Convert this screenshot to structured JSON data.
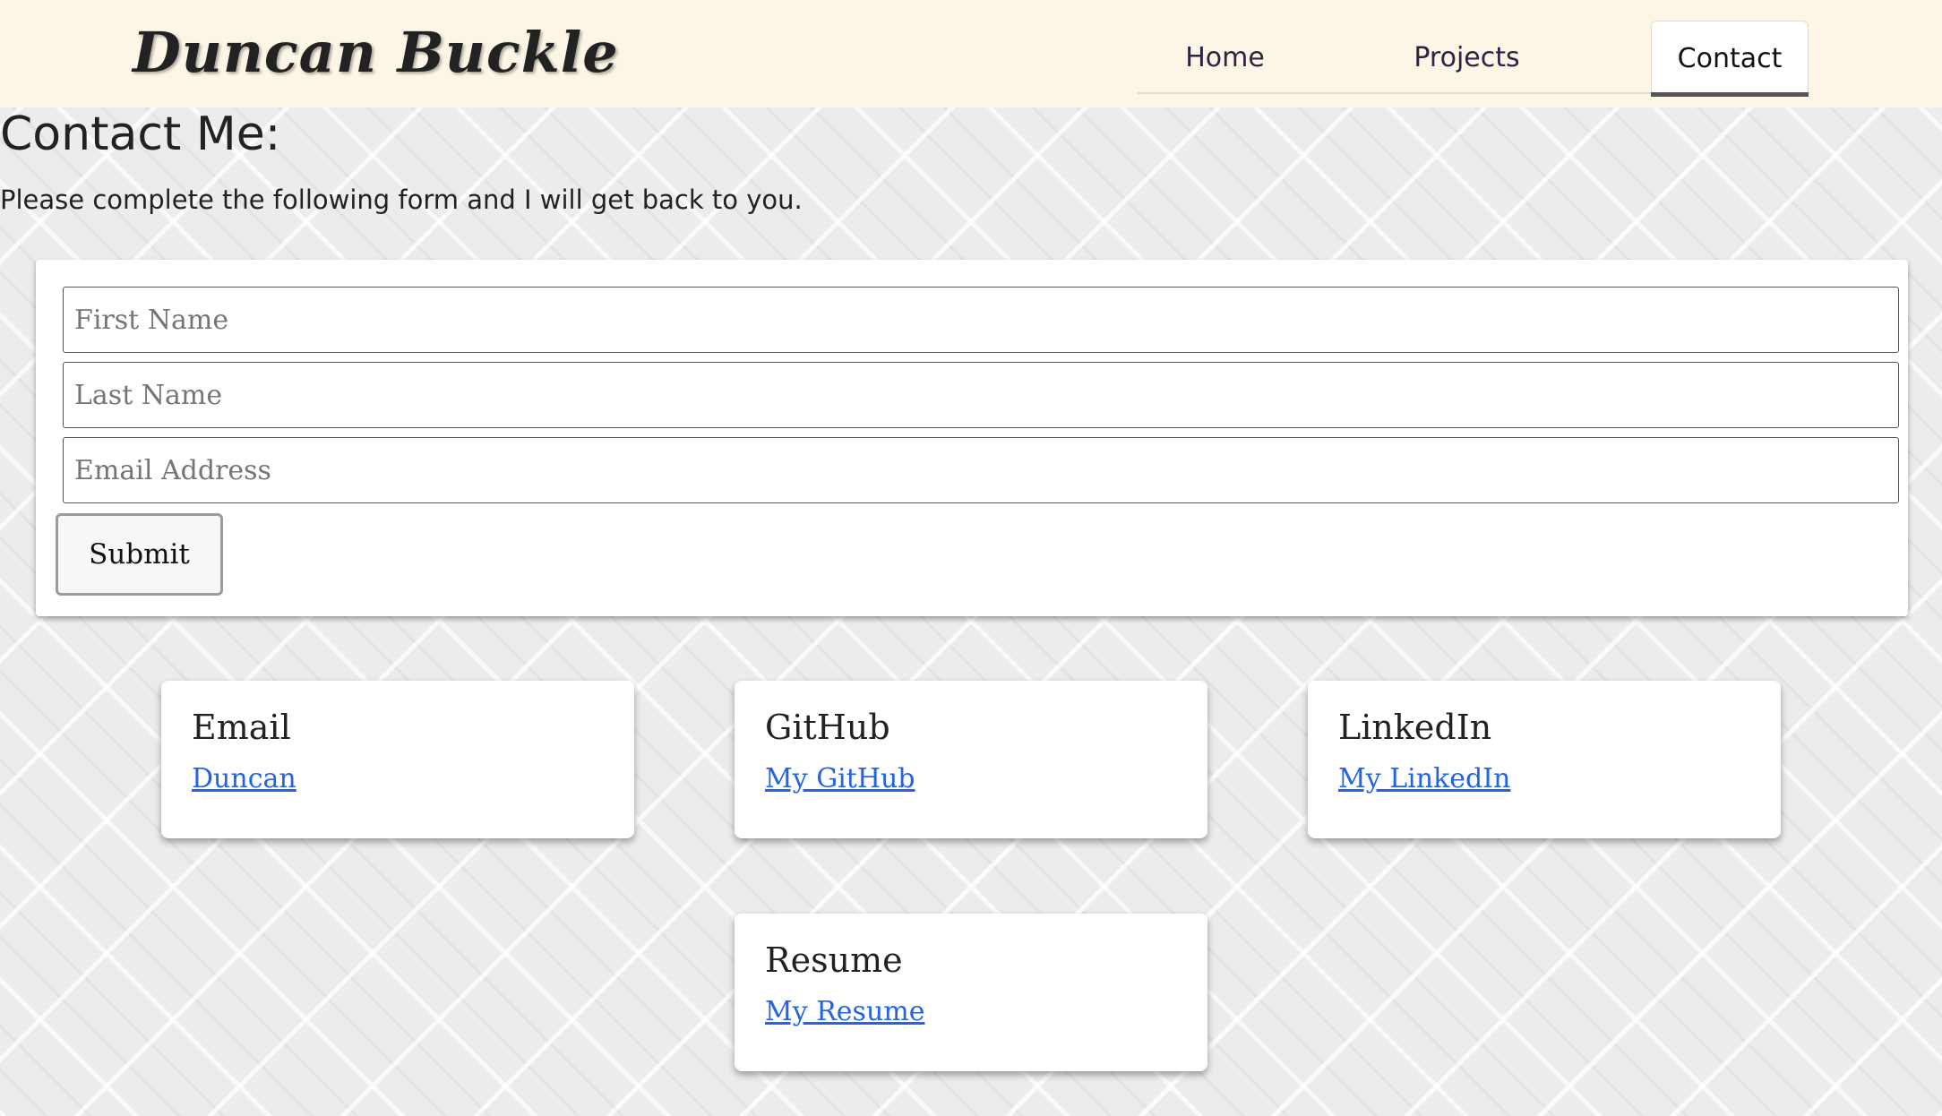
{
  "header": {
    "brand": "Duncan Buckle",
    "nav": {
      "home": "Home",
      "projects": "Projects",
      "contact": "Contact"
    }
  },
  "main": {
    "title": "Contact Me:",
    "intro": "Please complete the following form and I will get back to you.",
    "form": {
      "first_name_placeholder": "First Name",
      "last_name_placeholder": "Last Name",
      "email_placeholder": "Email Address",
      "submit_label": "Submit"
    },
    "cards": {
      "email": {
        "title": "Email",
        "link": "Duncan"
      },
      "github": {
        "title": "GitHub",
        "link": "My GitHub"
      },
      "linkedin": {
        "title": "LinkedIn",
        "link": "My LinkedIn"
      },
      "resume": {
        "title": "Resume",
        "link": "My Resume"
      }
    }
  },
  "colors": {
    "header_background": "#fdf6e6",
    "link": "#2462e8",
    "active_tab_underline": "#555555"
  }
}
